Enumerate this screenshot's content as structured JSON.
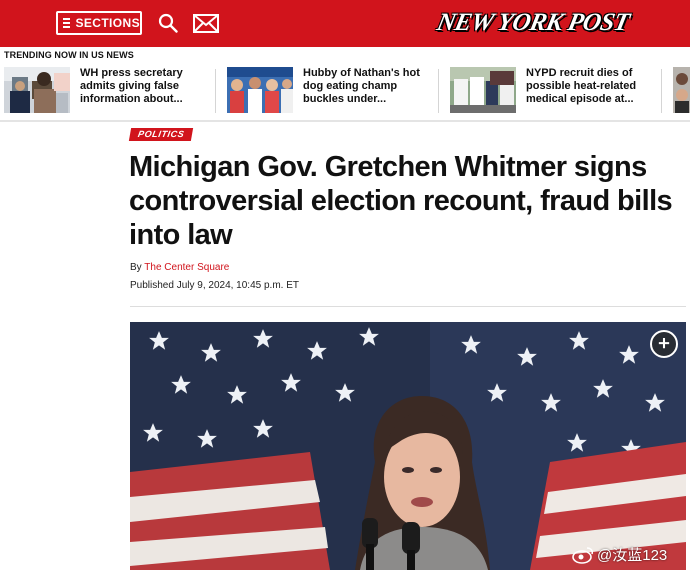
{
  "header": {
    "sections_label": "SECTIONS",
    "logo_text": "NEW YORK POST",
    "brand_color": "#d1141c",
    "icons": [
      "hamburger-icon",
      "search-icon",
      "mail-icon"
    ]
  },
  "trending": {
    "label": "TRENDING NOW IN US NEWS",
    "items": [
      {
        "text": "WH press secretary admits giving false information about..."
      },
      {
        "text": "Hubby of Nathan's hot dog eating champ buckles under..."
      },
      {
        "text": "NYPD recruit dies of possible heat-related medical episode at..."
      }
    ]
  },
  "article": {
    "category": "POLITICS",
    "headline": "Michigan Gov. Gretchen Whitmer signs controversial election recount, fraud bills into law",
    "byline_prefix": "By",
    "author": "The Center Square",
    "published": "Published July 9, 2024, 10:45 p.m. ET"
  },
  "watermark": {
    "text": "@汝蓝123"
  }
}
